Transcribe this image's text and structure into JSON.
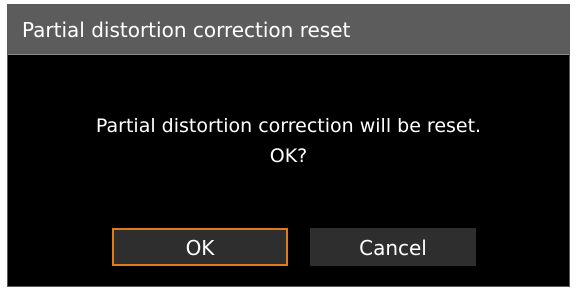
{
  "dialog": {
    "title": "Partial distortion correction reset",
    "message_line1": "Partial distortion correction will be reset.",
    "message_line2": "OK?",
    "buttons": {
      "ok_label": "OK",
      "cancel_label": "Cancel"
    },
    "focused_button": "OK",
    "colors": {
      "background": "#000000",
      "titlebar": "#5c5c5c",
      "button": "#2e2e2e",
      "focus_accent": "#e07a1e",
      "text": "#ffffff"
    }
  }
}
